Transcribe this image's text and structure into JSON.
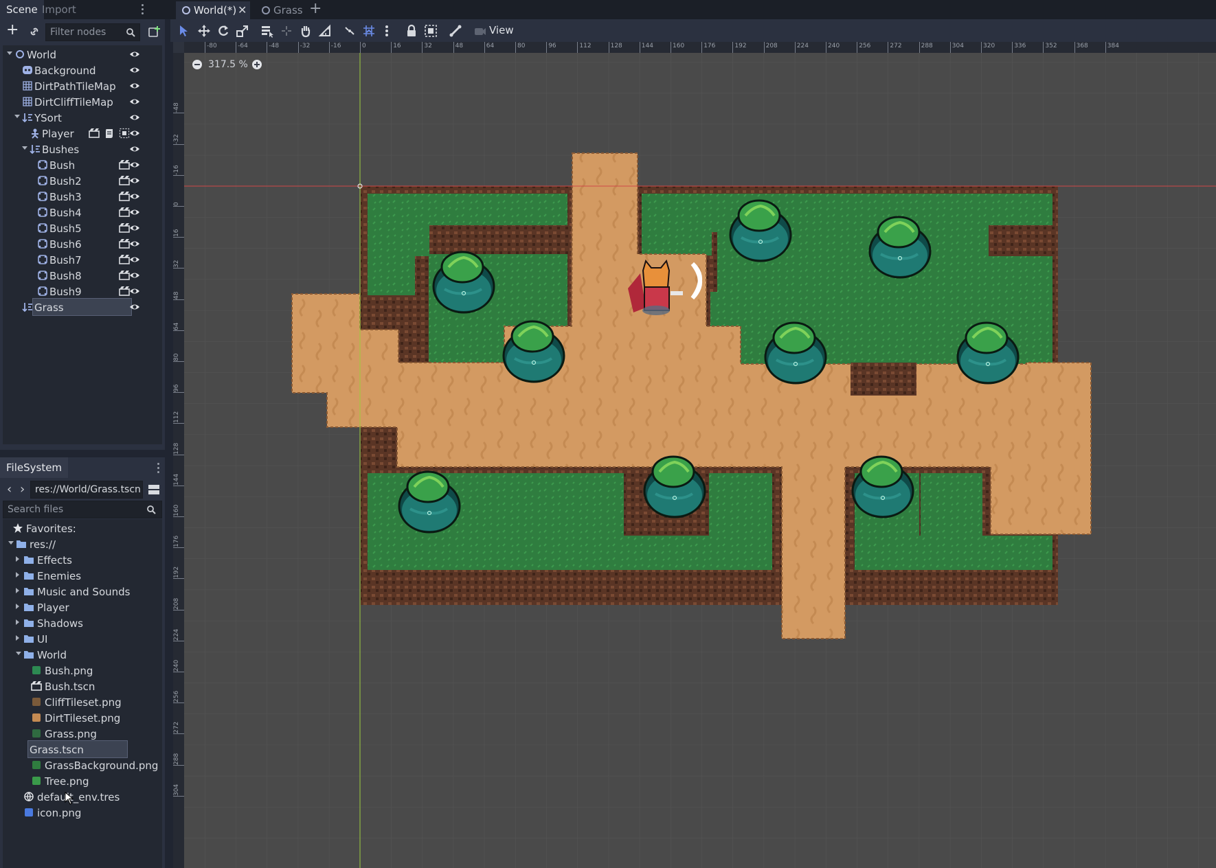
{
  "scene_dock": {
    "tabs": [
      "Scene",
      "Import"
    ],
    "filter_placeholder": "Filter nodes",
    "nodes": [
      {
        "label": "World",
        "depth": 0,
        "icon": "node2d-circle-icon",
        "expanded": true
      },
      {
        "label": "Background",
        "depth": 1,
        "icon": "sprite-icon"
      },
      {
        "label": "DirtPathTileMap",
        "depth": 1,
        "icon": "tilemap-icon"
      },
      {
        "label": "DirtCliffTileMap",
        "depth": 1,
        "icon": "tilemap-icon"
      },
      {
        "label": "YSort",
        "depth": 1,
        "icon": "ysort-icon",
        "expanded": true
      },
      {
        "label": "Player",
        "depth": 2,
        "icon": "kinematic-body-icon",
        "badges": [
          "instance-icon",
          "script-icon",
          "group-icon"
        ]
      },
      {
        "label": "Bushes",
        "depth": 2,
        "icon": "ysort-icon",
        "expanded": true
      },
      {
        "label": "Bush",
        "depth": 3,
        "icon": "static-body-icon",
        "badges": [
          "instance-icon"
        ]
      },
      {
        "label": "Bush2",
        "depth": 3,
        "icon": "static-body-icon",
        "badges": [
          "instance-icon"
        ]
      },
      {
        "label": "Bush3",
        "depth": 3,
        "icon": "static-body-icon",
        "badges": [
          "instance-icon"
        ]
      },
      {
        "label": "Bush4",
        "depth": 3,
        "icon": "static-body-icon",
        "badges": [
          "instance-icon"
        ]
      },
      {
        "label": "Bush5",
        "depth": 3,
        "icon": "static-body-icon",
        "badges": [
          "instance-icon"
        ]
      },
      {
        "label": "Bush6",
        "depth": 3,
        "icon": "static-body-icon",
        "badges": [
          "instance-icon"
        ]
      },
      {
        "label": "Bush7",
        "depth": 3,
        "icon": "static-body-icon",
        "badges": [
          "instance-icon"
        ]
      },
      {
        "label": "Bush8",
        "depth": 3,
        "icon": "static-body-icon",
        "badges": [
          "instance-icon"
        ]
      },
      {
        "label": "Bush9",
        "depth": 3,
        "icon": "static-body-icon",
        "badges": [
          "instance-icon"
        ]
      },
      {
        "label": "Grass",
        "depth": 1,
        "icon": "ysort-icon",
        "selected": true
      }
    ]
  },
  "filesystem": {
    "tab": "FileSystem",
    "path": "res://World/Grass.tscn",
    "search_placeholder": "Search files",
    "items": [
      {
        "label": "Favorites:",
        "depth": 0,
        "icon": "star-icon",
        "kind": "header"
      },
      {
        "label": "res://",
        "depth": 0,
        "icon": "folder-icon",
        "kind": "folder",
        "expanded": true
      },
      {
        "label": "Effects",
        "depth": 1,
        "icon": "folder-icon",
        "kind": "folder"
      },
      {
        "label": "Enemies",
        "depth": 1,
        "icon": "folder-icon",
        "kind": "folder"
      },
      {
        "label": "Music and Sounds",
        "depth": 1,
        "icon": "folder-icon",
        "kind": "folder"
      },
      {
        "label": "Player",
        "depth": 1,
        "icon": "folder-icon",
        "kind": "folder"
      },
      {
        "label": "Shadows",
        "depth": 1,
        "icon": "folder-icon",
        "kind": "folder"
      },
      {
        "label": "UI",
        "depth": 1,
        "icon": "folder-icon",
        "kind": "folder"
      },
      {
        "label": "World",
        "depth": 1,
        "icon": "folder-icon",
        "kind": "folder",
        "expanded": true
      },
      {
        "label": "Bush.png",
        "depth": 2,
        "icon": "image-thumb-icon",
        "kind": "file"
      },
      {
        "label": "Bush.tscn",
        "depth": 2,
        "icon": "scene-file-icon",
        "kind": "file"
      },
      {
        "label": "CliffTileset.png",
        "depth": 2,
        "icon": "image-thumb-icon",
        "kind": "file"
      },
      {
        "label": "DirtTileset.png",
        "depth": 2,
        "icon": "image-thumb-icon",
        "kind": "file"
      },
      {
        "label": "Grass.png",
        "depth": 2,
        "icon": "image-thumb-icon",
        "kind": "file"
      },
      {
        "label": "Grass.tscn",
        "depth": 2,
        "icon": "scene-file-icon",
        "kind": "file",
        "selected": true
      },
      {
        "label": "GrassBackground.png",
        "depth": 2,
        "icon": "image-thumb-icon",
        "kind": "file"
      },
      {
        "label": "Tree.png",
        "depth": 2,
        "icon": "image-thumb-icon",
        "kind": "file"
      },
      {
        "label": "default_env.tres",
        "depth": 1,
        "icon": "environment-icon",
        "kind": "file"
      },
      {
        "label": "icon.png",
        "depth": 1,
        "icon": "image-thumb-icon",
        "kind": "file"
      }
    ]
  },
  "editor_tabs": [
    {
      "label": "World(*)",
      "active": true
    },
    {
      "label": "Grass",
      "active": false
    }
  ],
  "toolbar": {
    "view_menu": "View",
    "zoom": "317.5 %"
  },
  "rulers": {
    "h_labels": [
      "-80",
      "-64",
      "-48",
      "-32",
      "-16",
      "0",
      "16",
      "32",
      "48",
      "64",
      "80",
      "96",
      "112",
      "128",
      "144",
      "160",
      "176",
      "192",
      "208",
      "224",
      "240",
      "256",
      "272",
      "288",
      "304",
      "320",
      "336",
      "352",
      "368",
      "384"
    ],
    "v_labels": [
      "-48",
      "-32",
      "-16",
      "0",
      "16",
      "32",
      "48",
      "64",
      "80",
      "96",
      "112",
      "128",
      "144",
      "160",
      "176",
      "192",
      "208",
      "224",
      "240",
      "256",
      "272",
      "288",
      "304"
    ]
  },
  "colors": {
    "accent": "#6b8ce8",
    "dirt": "#d39a62",
    "grass": "#2f7d3f",
    "cliff": "#6a3f2a",
    "viewport_bg": "#4a4a4a"
  }
}
